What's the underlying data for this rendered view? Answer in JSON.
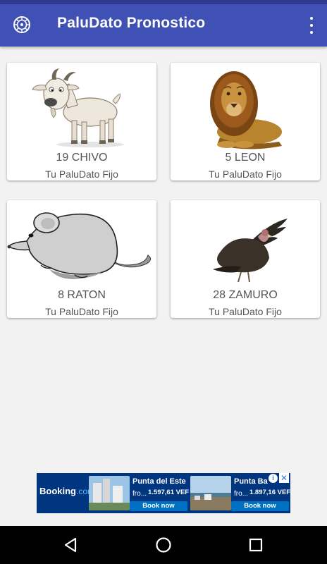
{
  "app": {
    "title": "PaluDato Pronostico",
    "icon": "roulette-wheel-icon",
    "menu_icon": "more-vert-icon",
    "bar_color": "#3f51b5"
  },
  "cards": [
    {
      "name": "19 CHIVO",
      "subtitle": "Tu PaluDato Fijo",
      "image": "goat-image"
    },
    {
      "name": "5 LEON",
      "subtitle": "Tu PaluDato Fijo",
      "image": "lion-image"
    },
    {
      "name": "8 RATON",
      "subtitle": "Tu PaluDato Fijo",
      "image": "mouse-image"
    },
    {
      "name": "28 ZAMURO",
      "subtitle": "Tu PaluDato Fijo",
      "image": "vulture-image"
    }
  ],
  "ad": {
    "brand": "Booking",
    "brand_suffix": ".com",
    "offers": [
      {
        "place": "Punta del Este",
        "from": "fro...",
        "price": "1.597,61 VEF",
        "button": "Book now"
      },
      {
        "place": "Punta Ba",
        "from": "fro...",
        "price": "1.897,16 VEF",
        "button": "Book now"
      }
    ],
    "adchoices_icon": "info-icon",
    "close_icon": "close-icon",
    "color": "#003580"
  },
  "navbar": {
    "back_icon": "back-triangle-icon",
    "home_icon": "home-circle-icon",
    "recents_icon": "recents-square-icon"
  }
}
